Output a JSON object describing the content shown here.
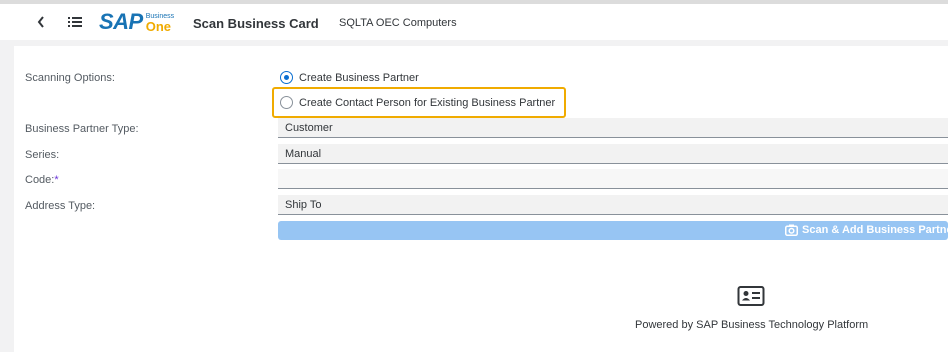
{
  "shell": {
    "logo_brand": "SAP",
    "logo_business": "Business",
    "logo_one": "One",
    "app_title": "Scan Business Card",
    "company": "SQLTA OEC Computers"
  },
  "form": {
    "scanning_options_label": "Scanning Options:",
    "options": [
      {
        "label": "Create Business Partner",
        "selected": true
      },
      {
        "label": "Create Contact Person for Existing Business Partner",
        "selected": false
      }
    ],
    "bp_type_label": "Business Partner Type:",
    "bp_type_value": "Customer",
    "series_label": "Series:",
    "series_value": "Manual",
    "code_label": "Code:",
    "code_required_mark": "*",
    "code_value": "",
    "address_type_label": "Address Type:",
    "address_type_value": "Ship To",
    "scan_button_label": "Scan & Add Business Partner"
  },
  "footer": {
    "powered_by": "Powered by SAP Business Technology Platform"
  },
  "colors": {
    "brand_blue": "#1873b4",
    "brand_gold": "#f0ab00",
    "highlight": "#f0ab00",
    "button_disabled": "#97c5f3",
    "radio_selected": "#0a6ed1"
  },
  "icons": [
    "back-icon",
    "menu-list-icon",
    "camera-icon",
    "business-card-icon"
  ]
}
